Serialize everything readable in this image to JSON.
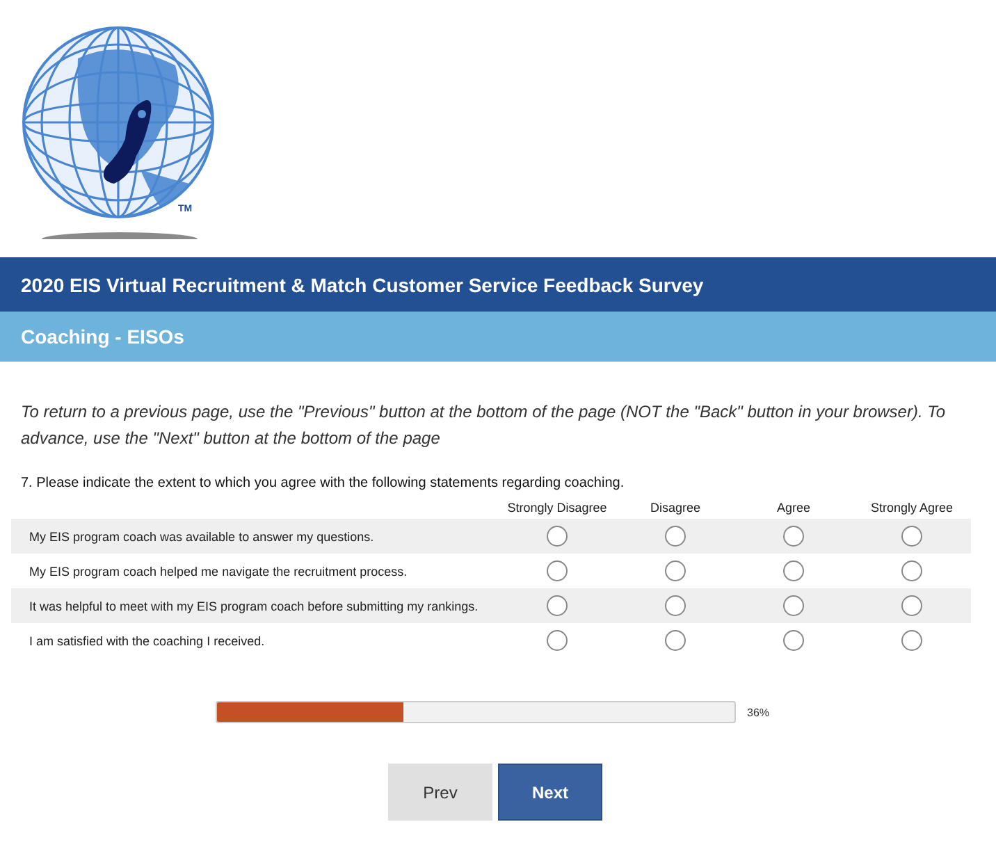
{
  "logo": {
    "trademark": "TM"
  },
  "survey_title": "2020 EIS Virtual Recruitment & Match Customer Service Feedback Survey",
  "page_title": "Coaching - EISOs",
  "instructions": "To return to a previous page, use the \"Previous\" button at the bottom of the page (NOT the \"Back\" button in your browser). To advance, use the \"Next\" button at the bottom of the page",
  "question": {
    "text": "7. Please indicate the extent to which you agree with the following statements regarding coaching.",
    "columns": [
      "Strongly Disagree",
      "Disagree",
      "Agree",
      "Strongly Agree"
    ],
    "rows": [
      {
        "label": "My EIS program coach was available to answer my questions.",
        "choices": [
          {
            "selected": false
          },
          {
            "selected": false
          },
          {
            "selected": false
          },
          {
            "selected": false
          }
        ]
      },
      {
        "label": "My EIS program coach helped me navigate the recruitment process.",
        "choices": [
          {
            "selected": false
          },
          {
            "selected": false
          },
          {
            "selected": false
          },
          {
            "selected": false
          }
        ]
      },
      {
        "label": "It was helpful to meet with my EIS program coach before submitting my rankings.",
        "choices": [
          {
            "selected": false
          },
          {
            "selected": false
          },
          {
            "selected": false
          },
          {
            "selected": false
          }
        ]
      },
      {
        "label": "I am satisfied with the coaching I received.",
        "choices": [
          {
            "selected": false
          },
          {
            "selected": false
          },
          {
            "selected": false
          },
          {
            "selected": false
          }
        ]
      }
    ]
  },
  "progress": {
    "level": 0.36,
    "reading": "36%"
  },
  "buttons": [
    {
      "label": "Prev",
      "kind": "secondary"
    },
    {
      "label": "Next",
      "kind": "primary"
    }
  ]
}
